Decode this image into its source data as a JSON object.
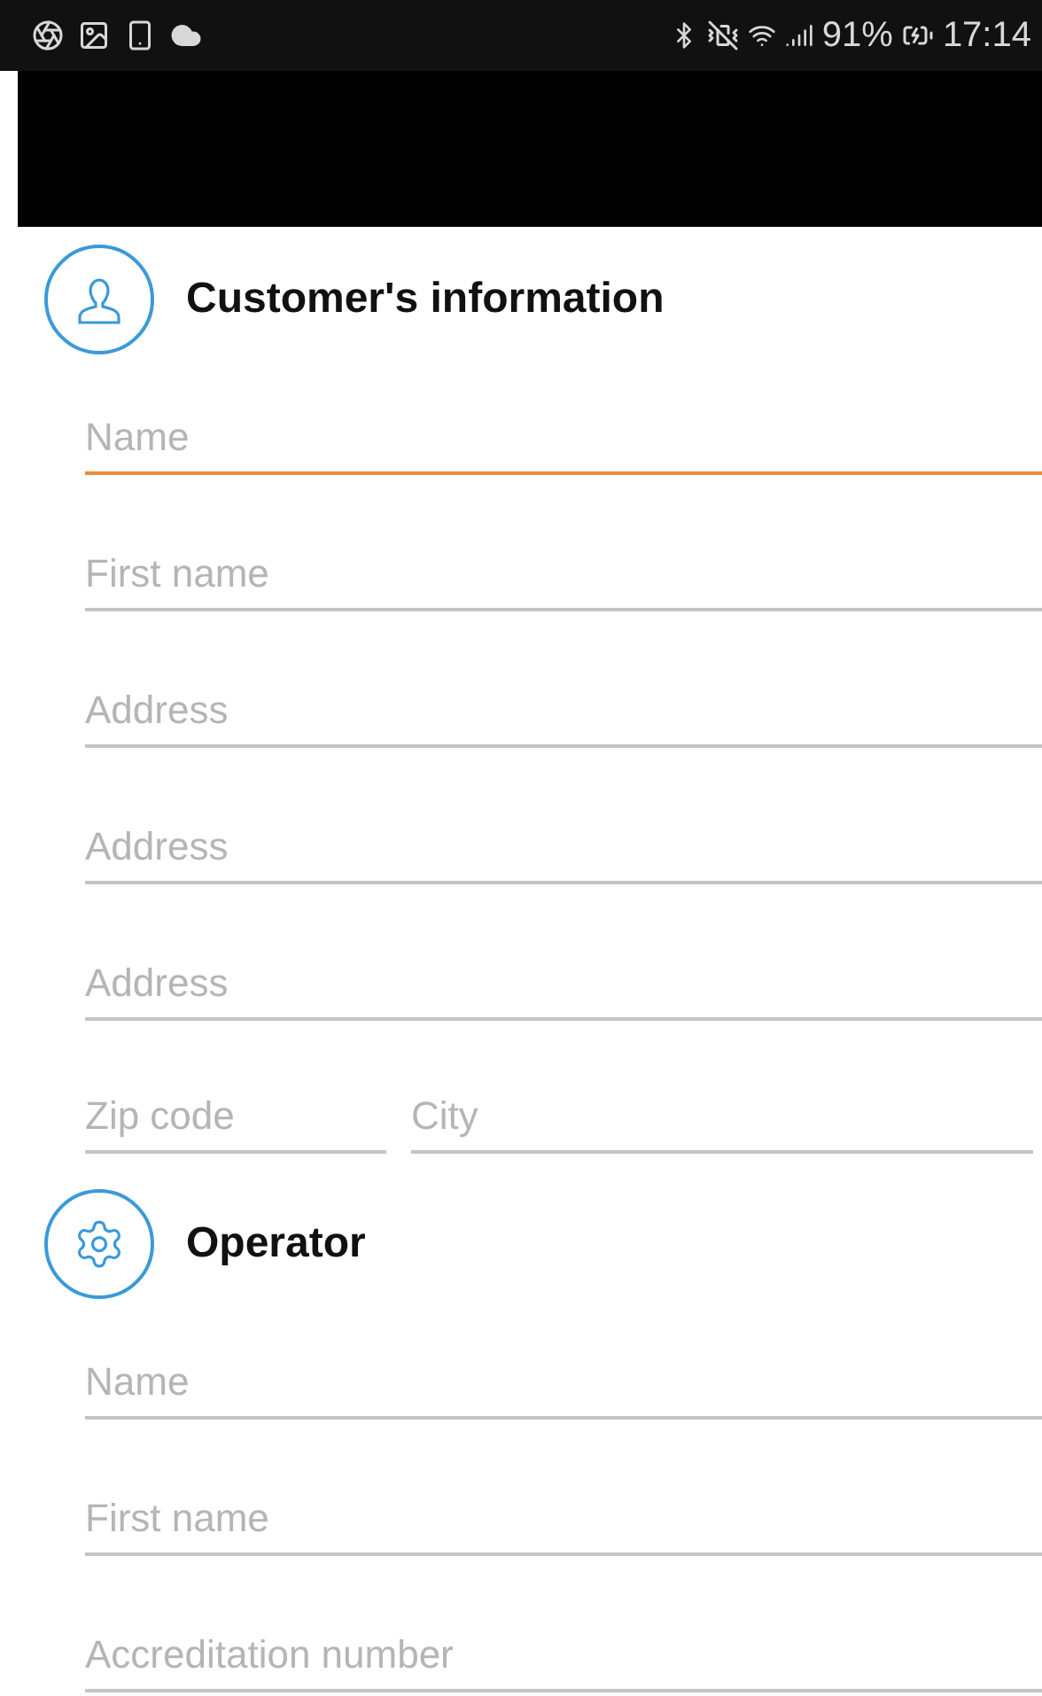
{
  "status_bar": {
    "battery": "91%",
    "time": "17:14"
  },
  "sections": [
    {
      "title": "Customer's information",
      "kind": "person",
      "rows": [
        {
          "fields": [
            {
              "placeholder": "Name",
              "focused": true
            }
          ]
        },
        {
          "fields": [
            {
              "placeholder": "First name",
              "focused": false
            }
          ]
        },
        {
          "fields": [
            {
              "placeholder": "Address",
              "focused": false
            }
          ]
        },
        {
          "fields": [
            {
              "placeholder": "Address",
              "focused": false
            }
          ]
        },
        {
          "fields": [
            {
              "placeholder": "Address",
              "focused": false
            }
          ]
        },
        {
          "fields": [
            {
              "placeholder": "Zip code",
              "focused": false
            },
            {
              "placeholder": "City",
              "focused": false
            }
          ]
        }
      ]
    },
    {
      "title": "Operator",
      "kind": "gear",
      "rows": [
        {
          "fields": [
            {
              "placeholder": "Name",
              "focused": false
            }
          ]
        },
        {
          "fields": [
            {
              "placeholder": "First name",
              "focused": false
            }
          ]
        },
        {
          "fields": [
            {
              "placeholder": "Accreditation number",
              "focused": false
            }
          ]
        }
      ]
    }
  ]
}
